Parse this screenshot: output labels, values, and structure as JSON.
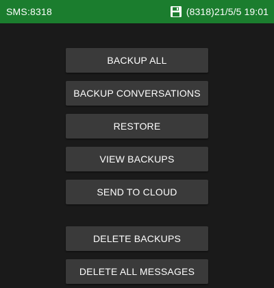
{
  "statusbar": {
    "left_text": "SMS:8318",
    "right_text": "(8318)21/5/5 19:01",
    "icon": "floppy-disk-icon",
    "color": "#1b7d2e"
  },
  "menu": {
    "backup_all": "BACKUP ALL",
    "backup_conversations": "BACKUP CONVERSATIONS",
    "restore": "RESTORE",
    "view_backups": "VIEW BACKUPS",
    "send_to_cloud": "SEND TO CLOUD",
    "delete_backups": "DELETE BACKUPS",
    "delete_all_messages": "DELETE ALL MESSAGES"
  }
}
